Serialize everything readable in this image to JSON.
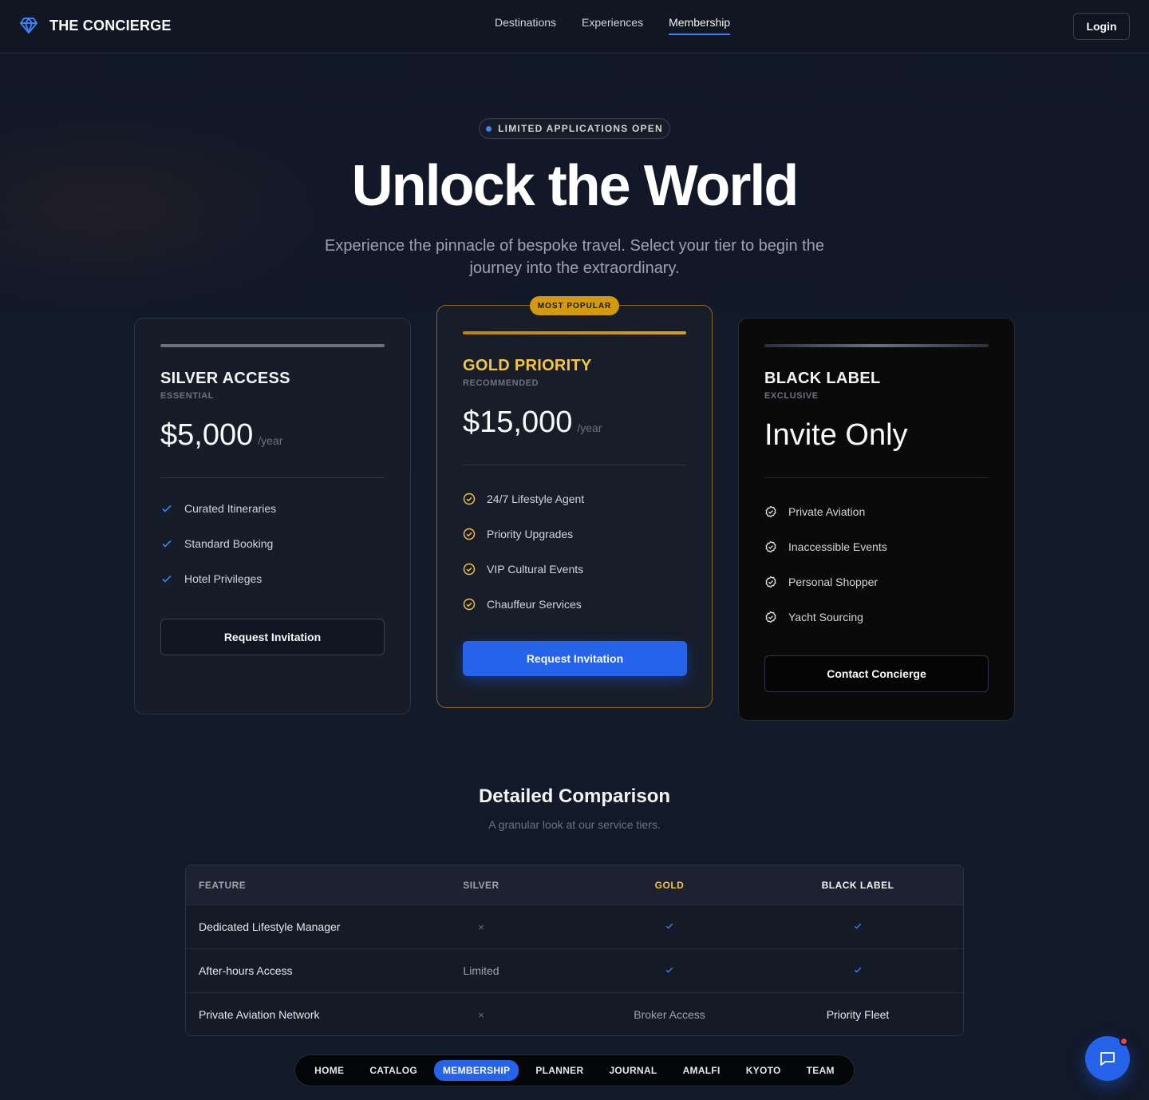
{
  "header": {
    "brand": "THE CONCIERGE",
    "nav": [
      "Destinations",
      "Experiences",
      "Membership"
    ],
    "active_nav": "Membership",
    "login_label": "Login"
  },
  "hero": {
    "pill": "LIMITED APPLICATIONS OPEN",
    "title": "Unlock the World",
    "subtitle": "Experience the pinnacle of bespoke travel. Select your tier to begin the journey into the extraordinary."
  },
  "tiers": [
    {
      "name": "SILVER ACCESS",
      "sub": "ESSENTIAL",
      "price": "$5,000",
      "per": "/year",
      "features": [
        "Curated Itineraries",
        "Standard Booking",
        "Hotel Privileges"
      ],
      "button": "Request Invitation"
    },
    {
      "badge": "MOST POPULAR",
      "name": "GOLD PRIORITY",
      "sub": "RECOMMENDED",
      "price": "$15,000",
      "per": "/year",
      "features": [
        "24/7 Lifestyle Agent",
        "Priority Upgrades",
        "VIP Cultural Events",
        "Chauffeur Services"
      ],
      "button": "Request Invitation"
    },
    {
      "name": "BLACK LABEL",
      "sub": "EXCLUSIVE",
      "price": "Invite Only",
      "features": [
        "Private Aviation",
        "Inaccessible Events",
        "Personal Shopper",
        "Yacht Sourcing"
      ],
      "button": "Contact Concierge"
    }
  ],
  "comparison": {
    "title": "Detailed Comparison",
    "subtitle": "A granular look at our service tiers.",
    "headers": [
      "FEATURE",
      "SILVER",
      "GOLD",
      "BLACK LABEL"
    ],
    "rows": [
      [
        "Dedicated Lifestyle Manager",
        "×",
        "✓",
        "✓"
      ],
      [
        "After-hours Access",
        "Limited",
        "✓",
        "✓"
      ],
      [
        "Private Aviation Network",
        "×",
        "Broker Access",
        "Priority Fleet"
      ]
    ]
  },
  "bottom_nav": {
    "items": [
      "HOME",
      "CATALOG",
      "MEMBERSHIP",
      "PLANNER",
      "JOURNAL",
      "AMALFI",
      "KYOTO",
      "TEAM"
    ],
    "active": "MEMBERSHIP"
  },
  "colors": {
    "accent": "#2563eb",
    "gold": "#f5c542",
    "background": "#111827"
  },
  "icons": {
    "brand": "diamond-icon",
    "chat": "chat-bubble-icon"
  }
}
